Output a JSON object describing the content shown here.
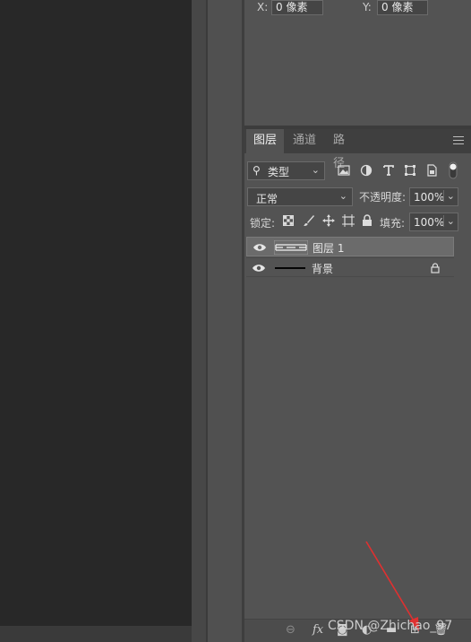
{
  "properties": {
    "x_label": "X:",
    "x_value": "0 像素",
    "y_label": "Y:",
    "y_value": "0 像素"
  },
  "tabs": [
    {
      "label": "图层",
      "active": true
    },
    {
      "label": "通道",
      "active": false
    },
    {
      "label": "路径",
      "active": false
    }
  ],
  "filter": {
    "search_icon": "⚲",
    "kind_label": "类型",
    "icons": [
      "image-filter-icon",
      "adjustment-filter-icon",
      "type-filter-icon",
      "shape-filter-icon",
      "smart-object-filter-icon"
    ]
  },
  "blend": {
    "mode": "正常",
    "opacity_label": "不透明度:",
    "opacity_value": "100%"
  },
  "lock": {
    "label": "锁定:",
    "fill_label": "填充:",
    "fill_value": "100%"
  },
  "layers": [
    {
      "name": "图层 1",
      "selected": true,
      "visible": true,
      "locked": false
    },
    {
      "name": "背景",
      "selected": false,
      "visible": true,
      "locked": true
    }
  ],
  "watermark": "CSDN @Zhichao_97",
  "colors": {
    "panel_bg": "#535353",
    "canvas_bg": "#282828",
    "selected_row": "#6b6b6b",
    "arrow": "#e03030"
  }
}
